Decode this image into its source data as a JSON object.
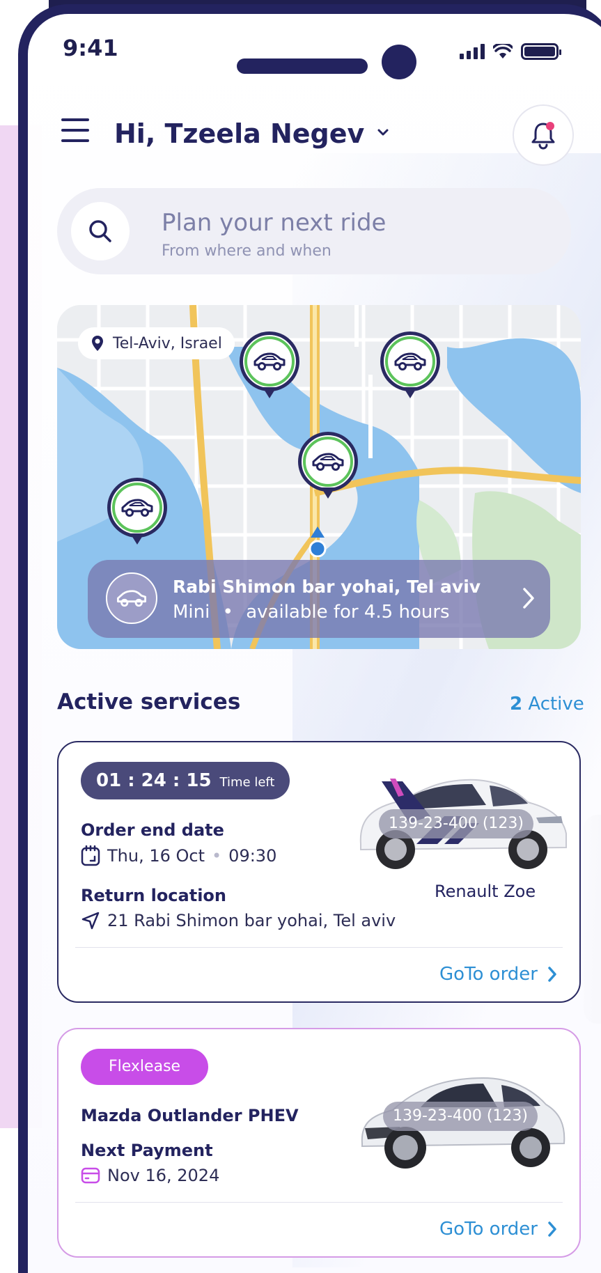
{
  "status_bar": {
    "time": "9:41"
  },
  "header": {
    "greeting": "Hi, Tzeela Negev"
  },
  "search": {
    "title": "Plan your next ride",
    "subtitle": "From where and when"
  },
  "map": {
    "location_label": "Tel-Aviv, Israel",
    "ride_card": {
      "title": "Rabi Shimon bar yohai, Tel aviv",
      "car_class": "Mini",
      "separator": "•",
      "availability": "available for 4.5 hours"
    }
  },
  "active_services": {
    "title": "Active services",
    "count": "2",
    "count_label": "Active"
  },
  "order_card": {
    "timer_value": "01 : 24 : 15",
    "timer_label": "Time left",
    "end_date_label": "Order end date",
    "end_date": "Thu, 16 Oct",
    "end_time_separator": "•",
    "end_time": "09:30",
    "return_label": "Return location",
    "return_address": "21 Rabi Shimon bar yohai, Tel aviv",
    "plate": "139-23-400 (123)",
    "car_model": "Renault Zoe",
    "link_label": "GoTo order"
  },
  "lease_card": {
    "badge": "Flexlease",
    "car_model": "Mazda Outlander PHEV",
    "payment_label": "Next Payment",
    "payment_date": "Nov 16, 2024",
    "plate": "139-23-400 (123)",
    "link_label": "GoTo order"
  },
  "colors": {
    "primary": "#23235f",
    "accent_blue": "#2d8fd4",
    "flexlease_purple": "#c84de8",
    "pin_green": "#5cc35b"
  },
  "icons": [
    "menu-icon",
    "chevron-down-icon",
    "bell-icon",
    "search-icon",
    "location-pin-icon",
    "car-icon",
    "chevron-right-icon",
    "calendar-icon",
    "navigation-arrow-icon",
    "credit-card-icon",
    "signal-icon",
    "wifi-icon",
    "battery-icon"
  ]
}
